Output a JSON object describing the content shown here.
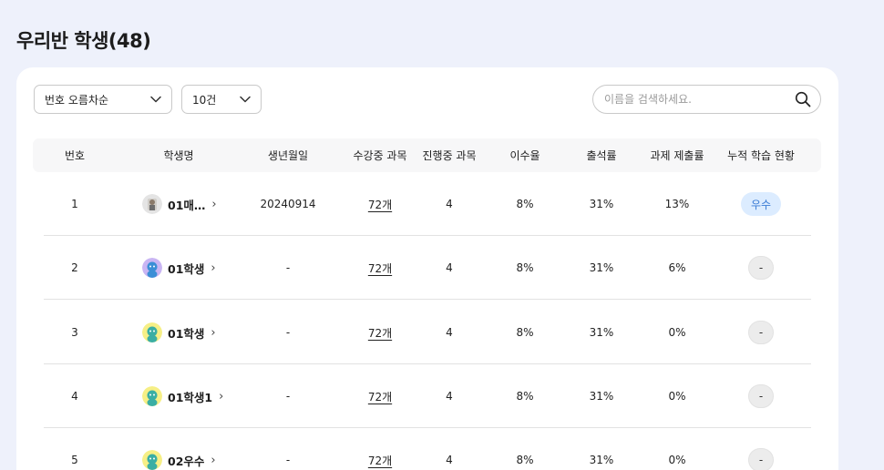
{
  "page": {
    "title": "우리반 학생(48)"
  },
  "filters": {
    "sort": {
      "selected": "번호 오름차순"
    },
    "count": {
      "selected": "10건"
    },
    "search": {
      "placeholder": "이름을 검색하세요.",
      "value": ""
    }
  },
  "table": {
    "headers": [
      "번호",
      "학생명",
      "생년월일",
      "수강중 과목",
      "진행중 과목",
      "이수율",
      "출석률",
      "과제 제출률",
      "누적 학습 현황"
    ],
    "rows": [
      {
        "no": "1",
        "name": "01매…",
        "avatar": "photo-avatar",
        "birth": "20240914",
        "enrolled": "72개",
        "ongoing": "4",
        "completion": "8%",
        "attendance": "31%",
        "submission": "13%",
        "status": "우수",
        "status_type": "good"
      },
      {
        "no": "2",
        "name": "01학생",
        "avatar": "purple-character-avatar",
        "birth": "-",
        "enrolled": "72개",
        "ongoing": "4",
        "completion": "8%",
        "attendance": "31%",
        "submission": "6%",
        "status": "-",
        "status_type": "none"
      },
      {
        "no": "3",
        "name": "01학생",
        "avatar": "yellow-character-avatar",
        "birth": "-",
        "enrolled": "72개",
        "ongoing": "4",
        "completion": "8%",
        "attendance": "31%",
        "submission": "0%",
        "status": "-",
        "status_type": "none"
      },
      {
        "no": "4",
        "name": "01학생1",
        "avatar": "yellow-character-avatar",
        "birth": "-",
        "enrolled": "72개",
        "ongoing": "4",
        "completion": "8%",
        "attendance": "31%",
        "submission": "0%",
        "status": "-",
        "status_type": "none"
      },
      {
        "no": "5",
        "name": "02우수",
        "avatar": "yellow-character-avatar",
        "birth": "-",
        "enrolled": "72개",
        "ongoing": "4",
        "completion": "8%",
        "attendance": "31%",
        "submission": "0%",
        "status": "-",
        "status_type": "none"
      }
    ]
  },
  "icons": {
    "arrow": "›",
    "chevron": "chevron-down-icon",
    "search": "search-icon"
  },
  "colors": {
    "background": "#eef1fb",
    "badge_good_bg": "#dcecff",
    "badge_good_text": "#3a7bd5",
    "badge_none_bg": "#ececec"
  }
}
